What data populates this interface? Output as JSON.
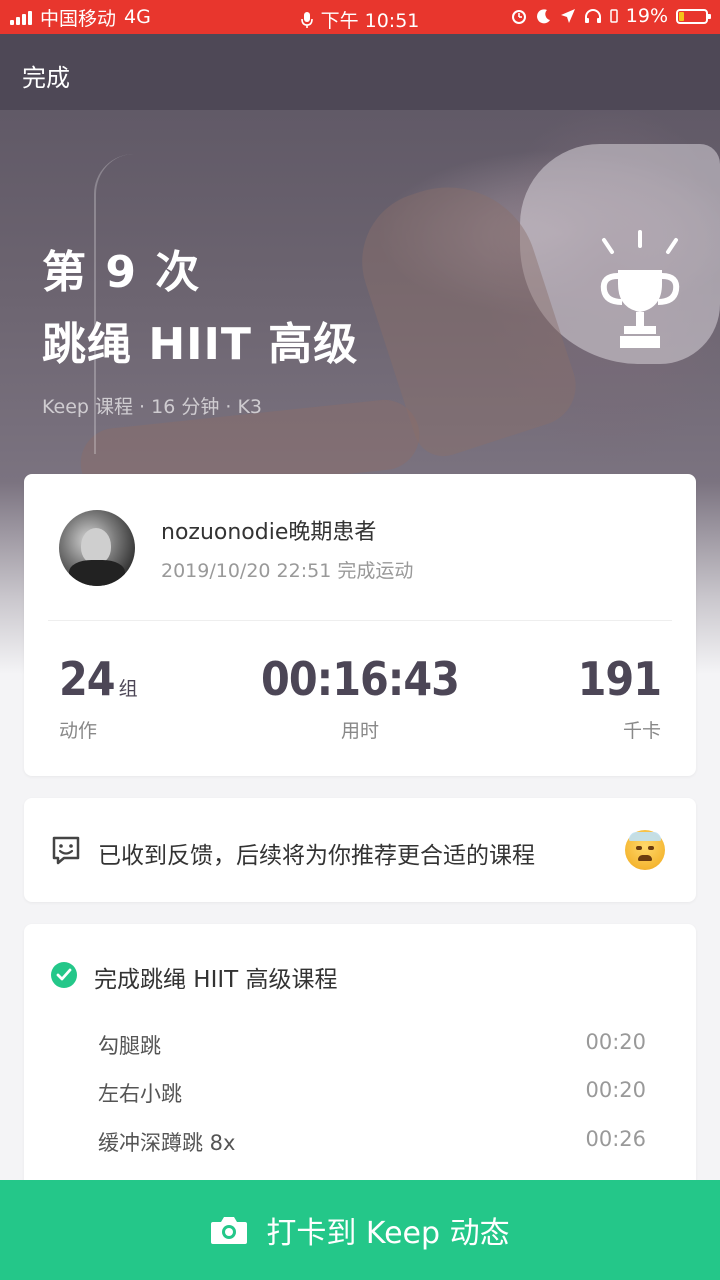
{
  "status_bar": {
    "carrier": "中国移动",
    "network": "4G",
    "time": "下午 10:51",
    "battery_percent": "19%"
  },
  "nav": {
    "done_label": "完成"
  },
  "hero": {
    "count": "第 9 次",
    "course_name": "跳绳 HIIT 高级",
    "meta": "Keep 课程 · 16 分钟 · K3"
  },
  "profile": {
    "username": "nozuonodie晚期患者",
    "finish_text": "2019/10/20 22:51 完成运动"
  },
  "stats": {
    "sets_value": "24",
    "sets_unit": "组",
    "sets_label": "动作",
    "duration_value": "00:16:43",
    "duration_label": "用时",
    "calories_value": "191",
    "calories_label": "千卡"
  },
  "feedback": {
    "text": "已收到反馈，后续将为你推荐更合适的课程"
  },
  "course": {
    "title": "完成跳绳 HIIT 高级课程",
    "exercises": [
      {
        "name": "勾腿跳",
        "time": "00:20"
      },
      {
        "name": "左右小跳",
        "time": "00:20"
      },
      {
        "name": "缓冲深蹲跳 8x",
        "time": "00:26"
      }
    ]
  },
  "bottom_button": {
    "label": "打卡到 Keep 动态"
  },
  "colors": {
    "status_bar": "#e8362d",
    "accent_green": "#24c789",
    "stat_text": "#4c4656"
  }
}
